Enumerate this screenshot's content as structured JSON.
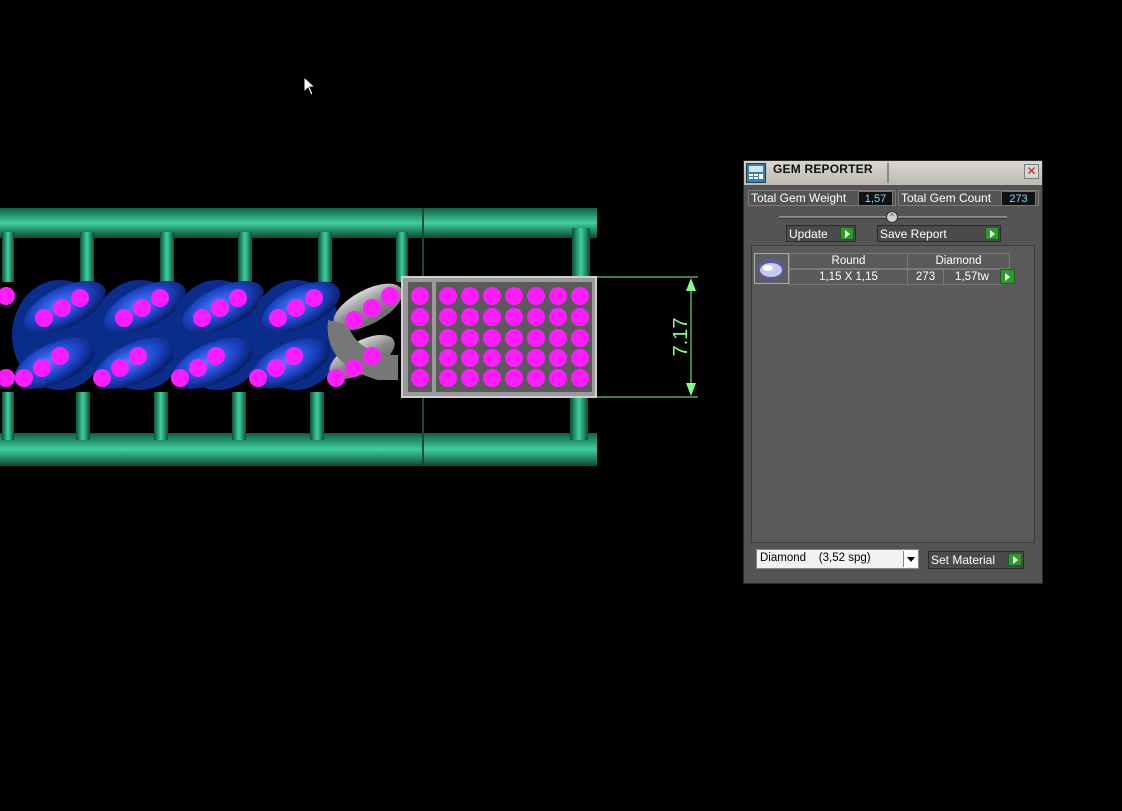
{
  "viewport": {
    "dimension_label": "7.17"
  },
  "gem_reporter": {
    "title": "GEM REPORTER",
    "total_gem_weight_label": "Total Gem Weight",
    "total_gem_weight_value": "1,57",
    "total_gem_count_label": "Total Gem Count",
    "total_gem_count_value": "273",
    "update_button": "Update",
    "save_report_button": "Save Report",
    "table": {
      "headers": [
        "Round",
        "Diamond"
      ],
      "rows": [
        {
          "size": "1,15 X 1,15",
          "count": "273",
          "weight": "1,57tw"
        }
      ]
    },
    "material_select": "Diamond    (3,52 spg)",
    "set_material_button": "Set Material"
  },
  "colors": {
    "gem": "#ff1dff",
    "link_blue": "#1a4fd6",
    "rail_green": "#1aa37a",
    "dimension": "#7dff8a",
    "accent_green": "#2e9a2e"
  }
}
